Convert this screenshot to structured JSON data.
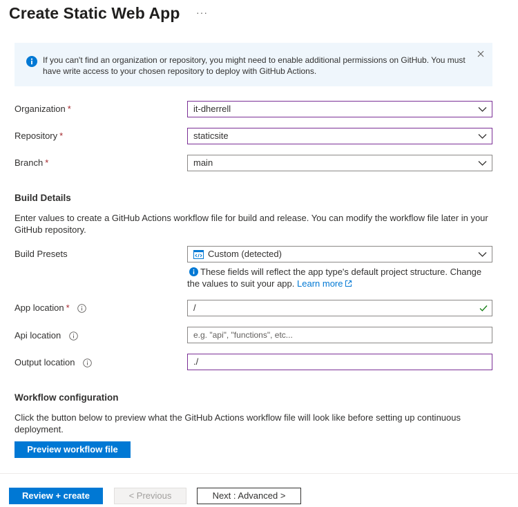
{
  "header": {
    "title": "Create Static Web App",
    "more_label": "···"
  },
  "info_bar": {
    "message": "If you can't find an organization or repository, you might need to enable additional permissions on GitHub. You must have write access to your chosen repository to deploy with GitHub Actions.",
    "icon": "info-icon",
    "dismiss_icon": "close-icon"
  },
  "source": {
    "organization": {
      "label": "Organization",
      "required_mark": "*",
      "value": "it-dherrell"
    },
    "repository": {
      "label": "Repository",
      "required_mark": "*",
      "value": "staticsite"
    },
    "branch": {
      "label": "Branch",
      "required_mark": "*",
      "value": "main"
    }
  },
  "build_details": {
    "heading": "Build Details",
    "description": "Enter values to create a GitHub Actions workflow file for build and release. You can modify the workflow file later in your GitHub repository.",
    "presets": {
      "label": "Build Presets",
      "value": "Custom (detected)",
      "icon": "code-file-icon",
      "hint": "These fields will reflect the app type's default project structure. Change the values to suit your app.",
      "learn_more": "Learn more"
    },
    "app_location": {
      "label": "App location",
      "required_mark": "*",
      "value": "/"
    },
    "api_location": {
      "label": "Api location",
      "placeholder": "e.g. \"api\", \"functions\", etc..."
    },
    "output_location": {
      "label": "Output location",
      "value": "./"
    }
  },
  "workflow": {
    "heading": "Workflow configuration",
    "description": "Click the button below to preview what the GitHub Actions workflow file will look like before setting up continuous deployment.",
    "preview_button": "Preview workflow file"
  },
  "footer": {
    "review_create": "Review + create",
    "previous": "< Previous",
    "next": "Next : Advanced >"
  },
  "colors": {
    "primary": "#0078d4",
    "focus_border": "#7a2e95",
    "required": "#a4262c",
    "info_background": "#eff6fc",
    "success_check": "#107c10"
  }
}
